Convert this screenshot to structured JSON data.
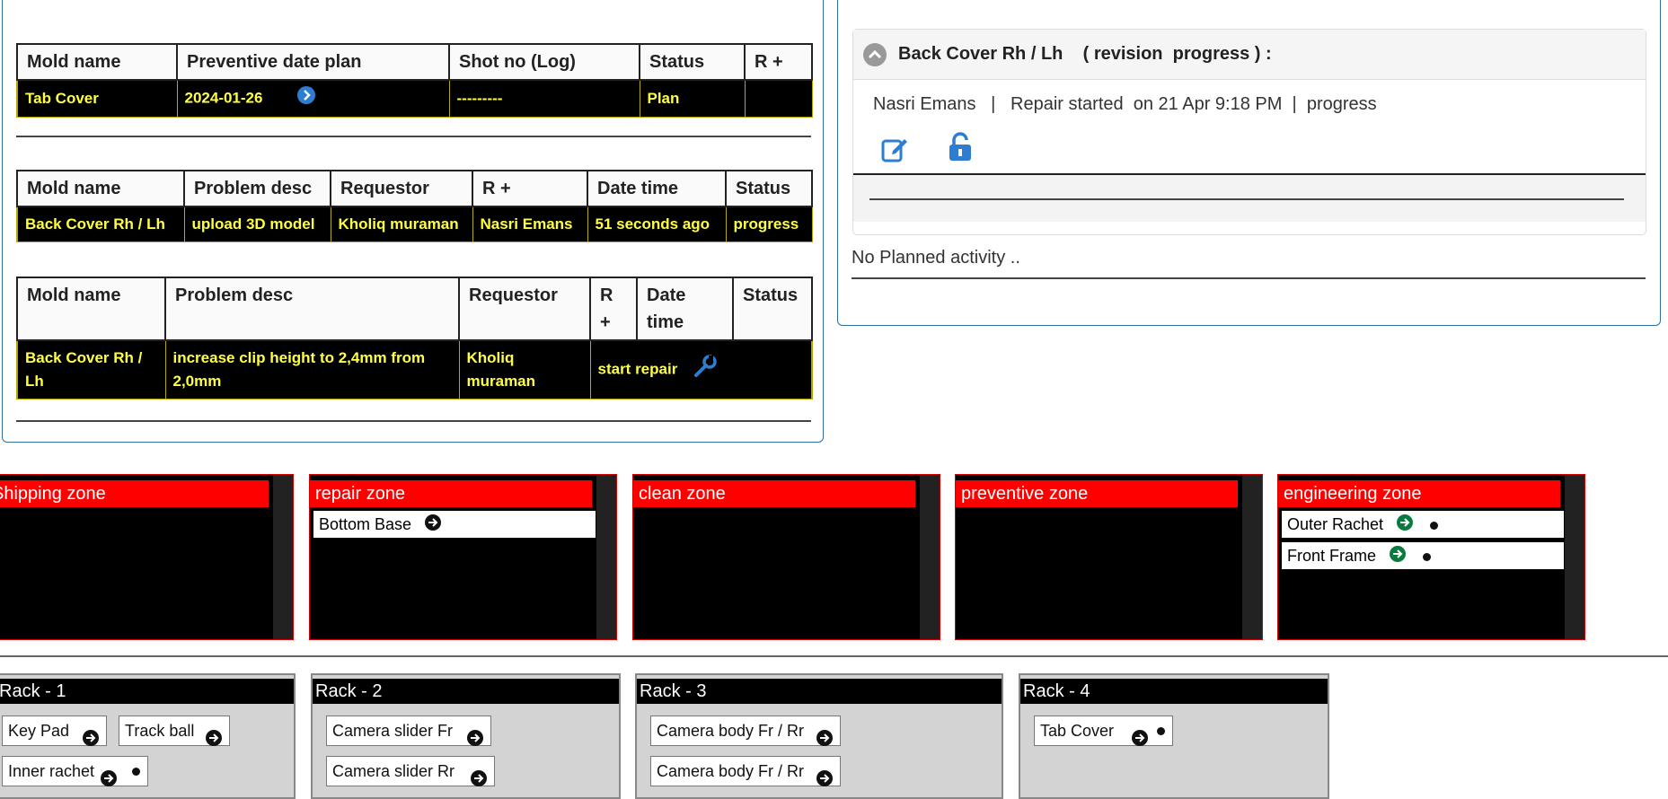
{
  "preventive_table": {
    "headers": [
      "Mold name",
      "Preventive date plan",
      "Shot no (Log)",
      "Status",
      "R +"
    ],
    "row": {
      "mold": "Tab Cover",
      "date": "2024-01-26",
      "shot": "---------",
      "status": "Plan",
      "r": ""
    }
  },
  "revision_table": {
    "headers": [
      "Mold name",
      "Problem desc",
      "Requestor",
      "R +",
      "Date time",
      "Status"
    ],
    "row": {
      "mold": "Back Cover Rh / Lh",
      "problem": "upload 3D model",
      "requestor": "Kholiq muraman",
      "r": "Nasri Emans",
      "datetime": "51 seconds ago",
      "status": "progress"
    }
  },
  "repair_table": {
    "headers": [
      "Mold name",
      "Problem desc",
      "Requestor",
      "R +",
      "Date time",
      "Status"
    ],
    "row": {
      "mold": "Back Cover Rh / Lh",
      "problem": "increase clip height to 2,4mm from 2,0mm",
      "requestor": "Kholiq muraman",
      "action": "start repair"
    }
  },
  "progress_card": {
    "title": "Back Cover Rh / Lh    ( revision  progress ) :",
    "info": "Nasri Emans   |   Repair started  on 21 Apr 9:18 PM  |  progress",
    "icons": [
      "edit-icon",
      "unlock-icon"
    ]
  },
  "planned_activity": "No Planned activity ..",
  "zones": [
    {
      "name": "Shipping zone",
      "items": []
    },
    {
      "name": "repair zone",
      "items": [
        {
          "label": "Bottom Base",
          "icon": "arrow-circle-icon",
          "dot": false
        }
      ]
    },
    {
      "name": "clean zone",
      "items": []
    },
    {
      "name": "preventive zone",
      "items": []
    },
    {
      "name": "engineering zone",
      "items": [
        {
          "label": "Outer Rachet",
          "icon": "arrow-circle-green-icon",
          "dot": true
        },
        {
          "label": "Front Frame",
          "icon": "arrow-circle-green-icon",
          "dot": true
        }
      ]
    }
  ],
  "racks": [
    {
      "name": "Rack - 1",
      "items": [
        "Key Pad",
        "Track ball",
        "Inner rachet"
      ]
    },
    {
      "name": "Rack - 2",
      "items": [
        "Camera slider Fr",
        "Camera slider Rr"
      ]
    },
    {
      "name": "Rack - 3",
      "items": [
        "Camera body Fr / Rr",
        "Camera body Fr / Rr"
      ]
    },
    {
      "name": "Rack - 4",
      "items": [
        "Tab Cover"
      ]
    }
  ],
  "colors": {
    "accent_blue": "#2e7dd1",
    "zone_red": "#ff0000",
    "table_text_yellow": "#ffff44",
    "arrow_green": "#0b7a3e"
  }
}
